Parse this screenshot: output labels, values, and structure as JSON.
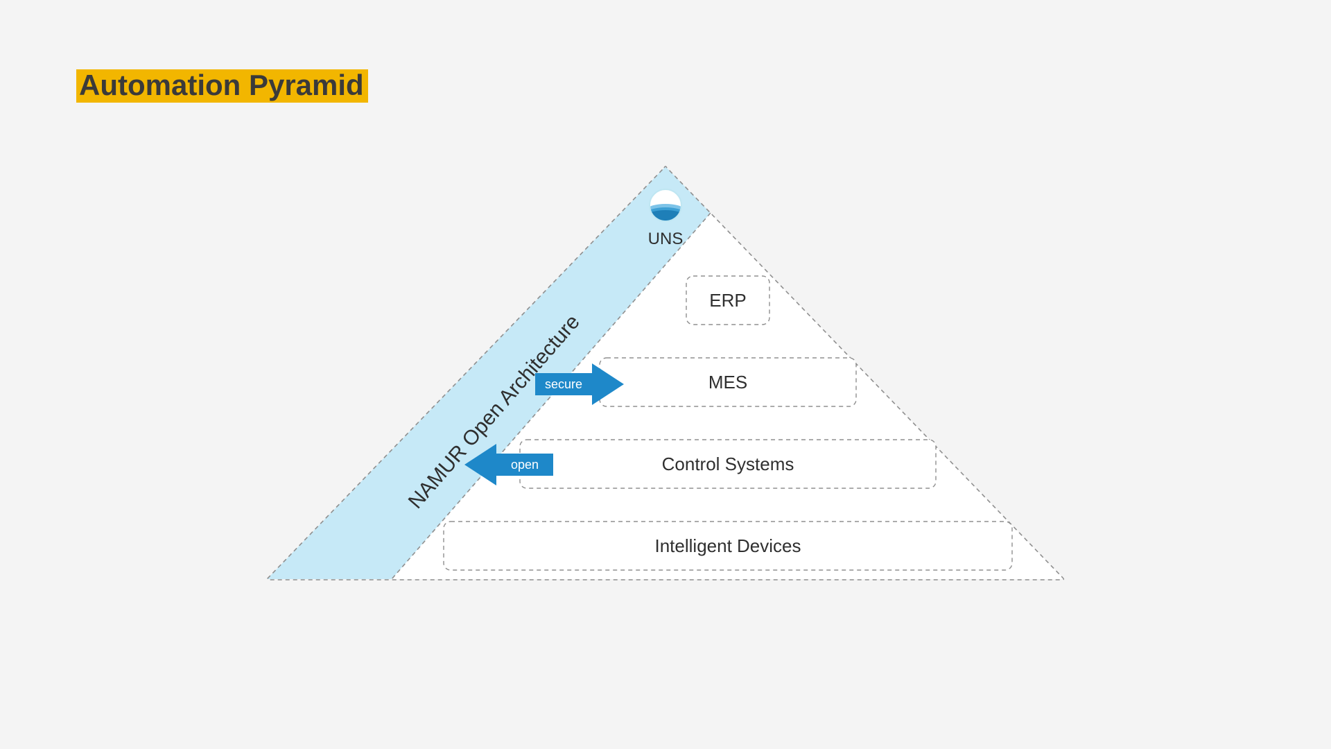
{
  "title": "Automation Pyramid",
  "apex_label": "UNS",
  "side_label": "NAMUR Open Architecture",
  "arrows": {
    "right": "secure",
    "left": "open"
  },
  "levels": {
    "l1": "ERP",
    "l2": "MES",
    "l3": "Control Systems",
    "l4": "Intelligent Devices"
  },
  "colors": {
    "highlight": "#f2b600",
    "side_fill": "#c6e9f7",
    "arrow_fill": "#1e88c9",
    "dash": "#8f8f8f",
    "text": "#2f2f2f"
  }
}
